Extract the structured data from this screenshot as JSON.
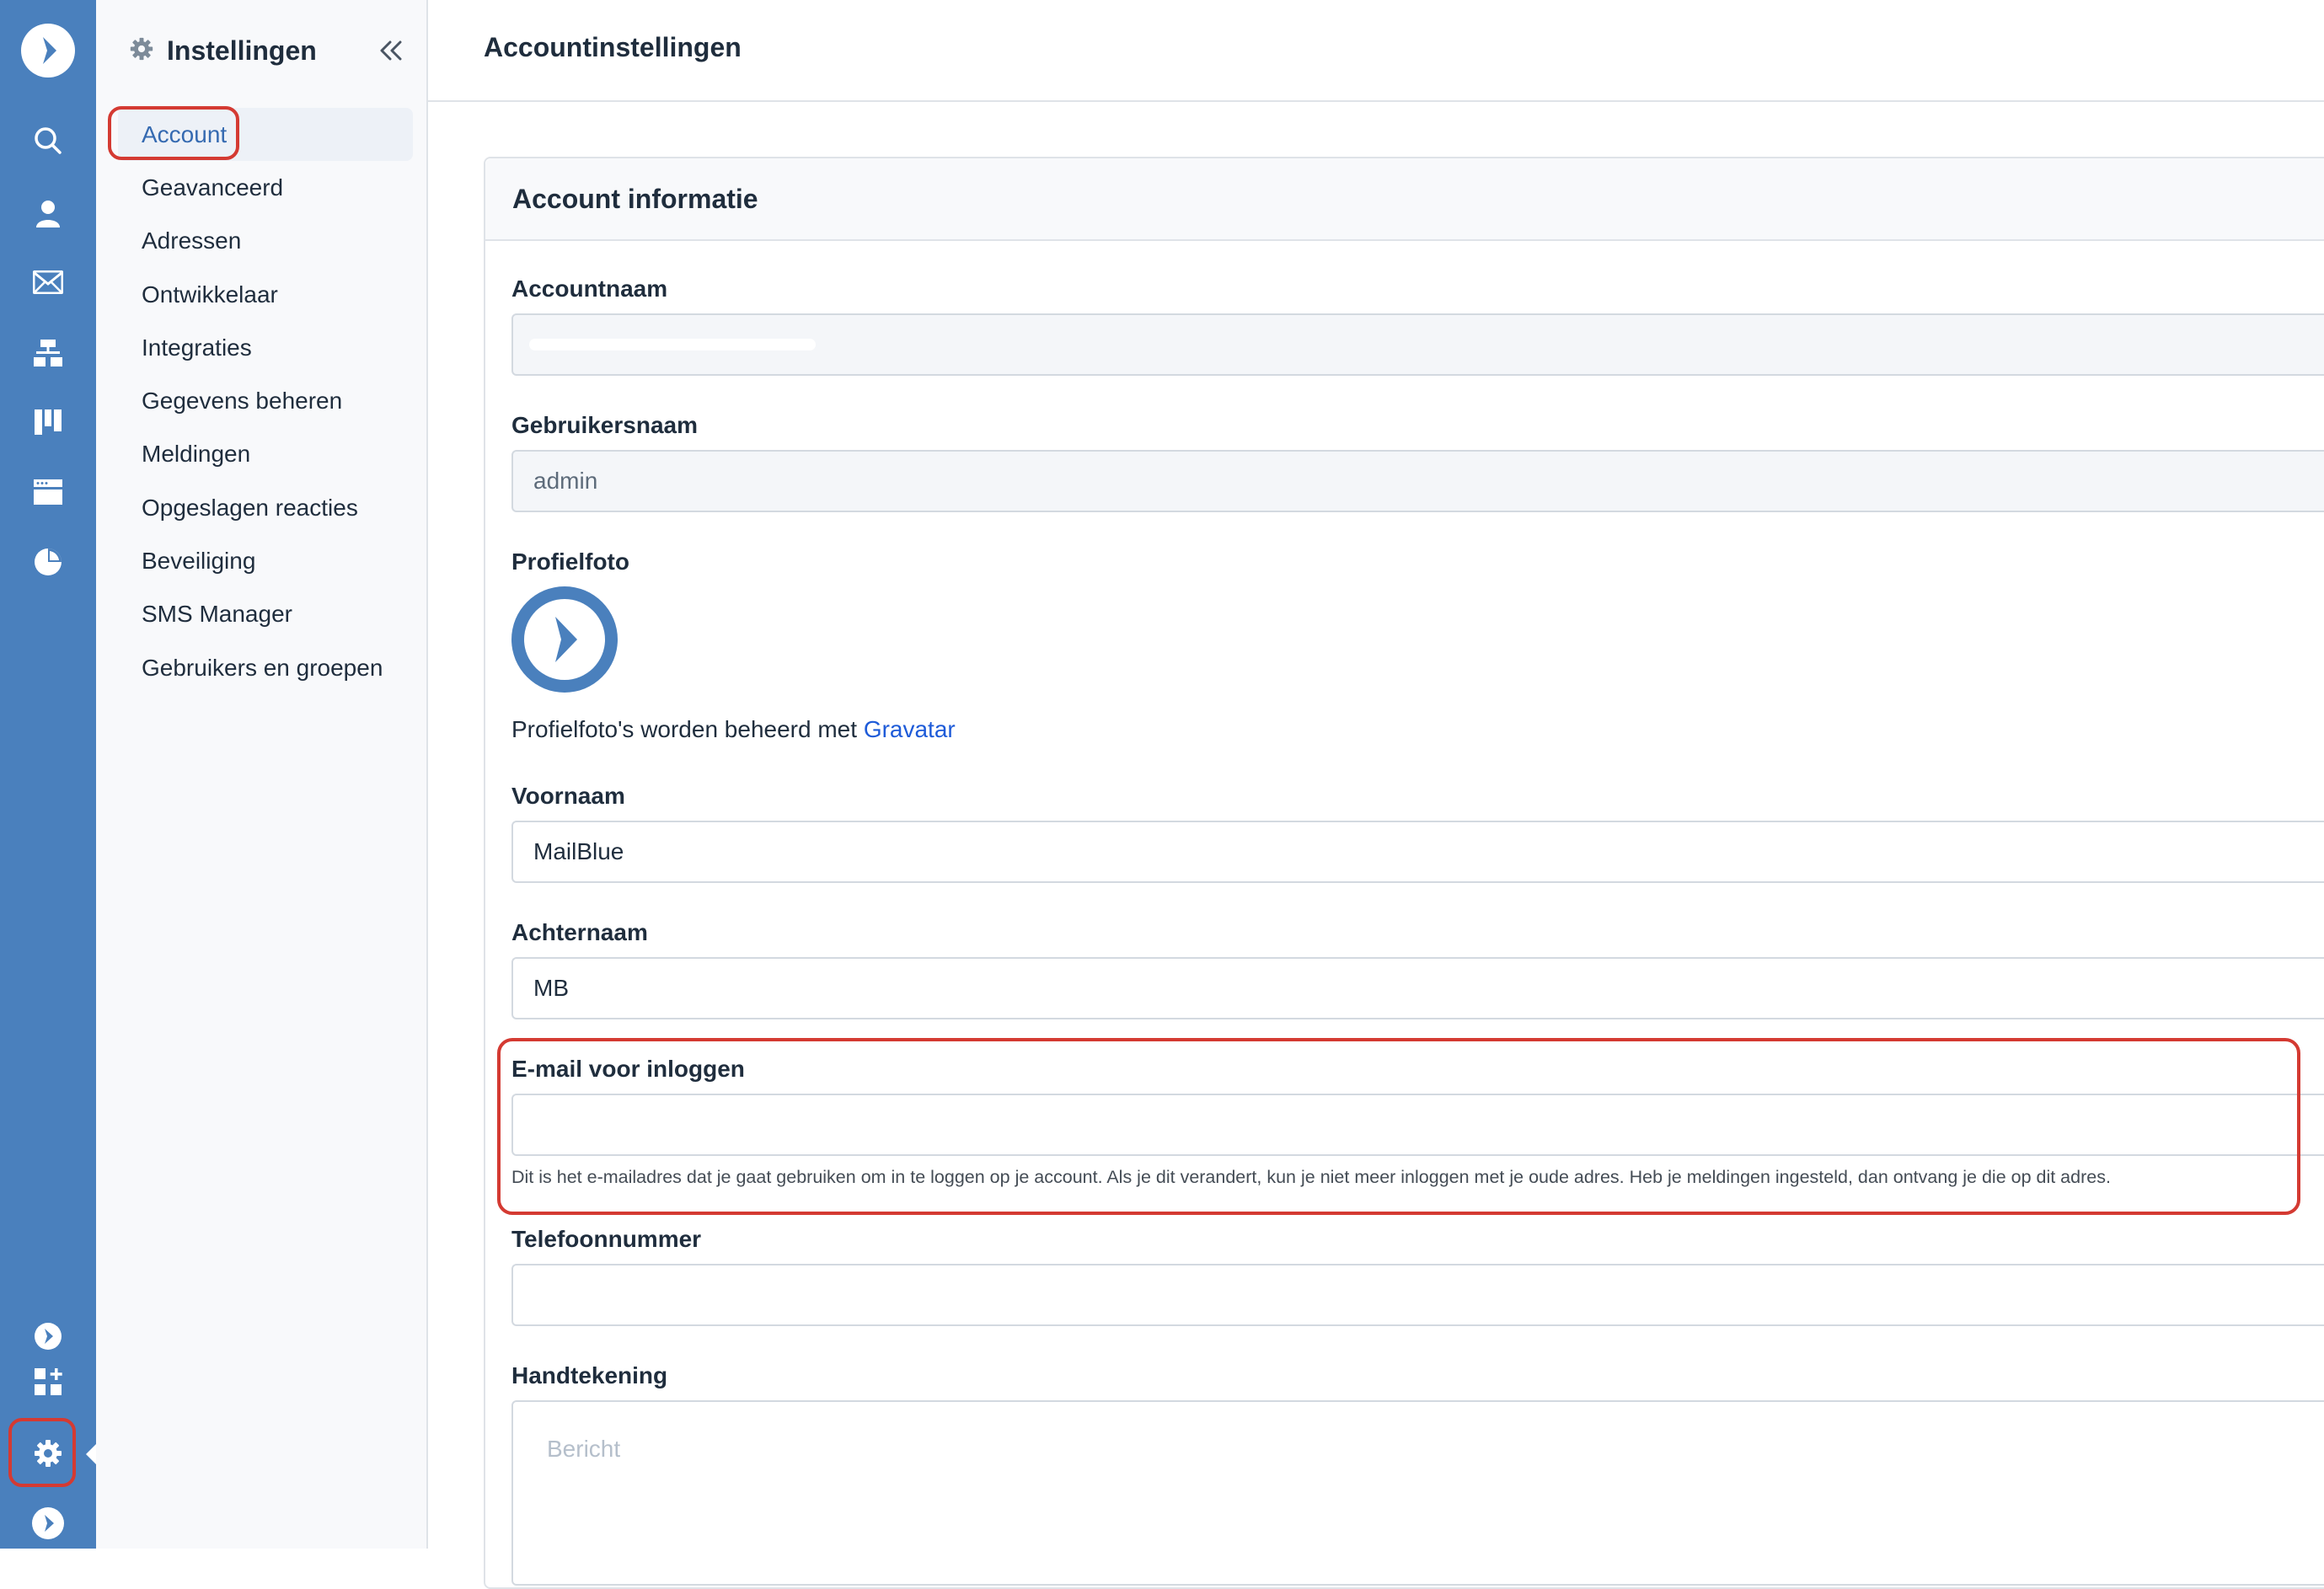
{
  "rail": {
    "icons": [
      "logo-icon",
      "search-icon",
      "contacts-icon",
      "email-icon",
      "automations-icon",
      "deals-icon",
      "website-icon",
      "reports-icon",
      "apps-icon",
      "add-apps-icon",
      "settings-icon",
      "brand-icon"
    ],
    "accent": "#4a80bd"
  },
  "sidebar": {
    "title": "Instellingen",
    "items": [
      {
        "label": "Account",
        "active": true
      },
      {
        "label": "Geavanceerd"
      },
      {
        "label": "Adressen"
      },
      {
        "label": "Ontwikkelaar"
      },
      {
        "label": "Integraties"
      },
      {
        "label": "Gegevens beheren"
      },
      {
        "label": "Meldingen"
      },
      {
        "label": "Opgeslagen reacties"
      },
      {
        "label": "Beveiliging"
      },
      {
        "label": "SMS Manager"
      },
      {
        "label": "Gebruikers en groepen"
      }
    ]
  },
  "header": {
    "title": "Accountinstellingen"
  },
  "card": {
    "title": "Account informatie",
    "account_name": {
      "label": "Accountnaam",
      "value": ""
    },
    "username": {
      "label": "Gebruikersnaam",
      "value": "admin"
    },
    "profile_photo": {
      "label": "Profielfoto",
      "note": "Profielfoto's worden beheerd met ",
      "link": "Gravatar"
    },
    "first_name": {
      "label": "Voornaam",
      "value": "MailBlue"
    },
    "last_name": {
      "label": "Achternaam",
      "value": "MB"
    },
    "login_email": {
      "label": "E-mail voor inloggen",
      "value": "",
      "help": "Dit is het e-mailadres dat je gaat gebruiken om in te loggen op je account. Als je dit verandert, kun je niet meer inloggen met je oude adres. Heb je meldingen ingesteld, dan ontvang je die op dit adres."
    },
    "phone": {
      "label": "Telefoonnummer",
      "value": ""
    },
    "signature": {
      "label": "Handtekening",
      "placeholder": "Bericht"
    }
  },
  "colors": {
    "highlight": "#d43a32",
    "link": "#1e5bd8"
  }
}
